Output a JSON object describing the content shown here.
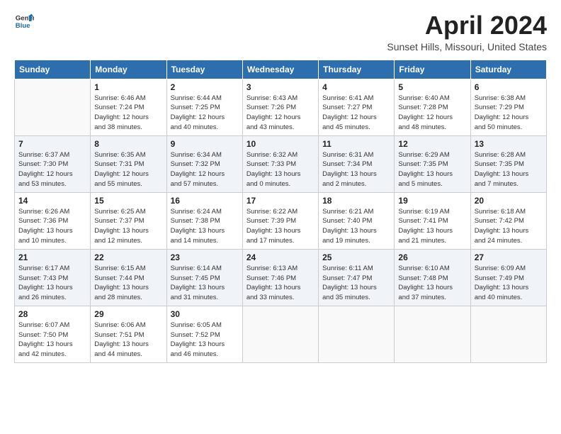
{
  "logo": {
    "general": "General",
    "blue": "Blue"
  },
  "title": "April 2024",
  "subtitle": "Sunset Hills, Missouri, United States",
  "headers": [
    "Sunday",
    "Monday",
    "Tuesday",
    "Wednesday",
    "Thursday",
    "Friday",
    "Saturday"
  ],
  "weeks": [
    [
      {
        "day": "",
        "info": ""
      },
      {
        "day": "1",
        "info": "Sunrise: 6:46 AM\nSunset: 7:24 PM\nDaylight: 12 hours\nand 38 minutes."
      },
      {
        "day": "2",
        "info": "Sunrise: 6:44 AM\nSunset: 7:25 PM\nDaylight: 12 hours\nand 40 minutes."
      },
      {
        "day": "3",
        "info": "Sunrise: 6:43 AM\nSunset: 7:26 PM\nDaylight: 12 hours\nand 43 minutes."
      },
      {
        "day": "4",
        "info": "Sunrise: 6:41 AM\nSunset: 7:27 PM\nDaylight: 12 hours\nand 45 minutes."
      },
      {
        "day": "5",
        "info": "Sunrise: 6:40 AM\nSunset: 7:28 PM\nDaylight: 12 hours\nand 48 minutes."
      },
      {
        "day": "6",
        "info": "Sunrise: 6:38 AM\nSunset: 7:29 PM\nDaylight: 12 hours\nand 50 minutes."
      }
    ],
    [
      {
        "day": "7",
        "info": "Sunrise: 6:37 AM\nSunset: 7:30 PM\nDaylight: 12 hours\nand 53 minutes."
      },
      {
        "day": "8",
        "info": "Sunrise: 6:35 AM\nSunset: 7:31 PM\nDaylight: 12 hours\nand 55 minutes."
      },
      {
        "day": "9",
        "info": "Sunrise: 6:34 AM\nSunset: 7:32 PM\nDaylight: 12 hours\nand 57 minutes."
      },
      {
        "day": "10",
        "info": "Sunrise: 6:32 AM\nSunset: 7:33 PM\nDaylight: 13 hours\nand 0 minutes."
      },
      {
        "day": "11",
        "info": "Sunrise: 6:31 AM\nSunset: 7:34 PM\nDaylight: 13 hours\nand 2 minutes."
      },
      {
        "day": "12",
        "info": "Sunrise: 6:29 AM\nSunset: 7:35 PM\nDaylight: 13 hours\nand 5 minutes."
      },
      {
        "day": "13",
        "info": "Sunrise: 6:28 AM\nSunset: 7:35 PM\nDaylight: 13 hours\nand 7 minutes."
      }
    ],
    [
      {
        "day": "14",
        "info": "Sunrise: 6:26 AM\nSunset: 7:36 PM\nDaylight: 13 hours\nand 10 minutes."
      },
      {
        "day": "15",
        "info": "Sunrise: 6:25 AM\nSunset: 7:37 PM\nDaylight: 13 hours\nand 12 minutes."
      },
      {
        "day": "16",
        "info": "Sunrise: 6:24 AM\nSunset: 7:38 PM\nDaylight: 13 hours\nand 14 minutes."
      },
      {
        "day": "17",
        "info": "Sunrise: 6:22 AM\nSunset: 7:39 PM\nDaylight: 13 hours\nand 17 minutes."
      },
      {
        "day": "18",
        "info": "Sunrise: 6:21 AM\nSunset: 7:40 PM\nDaylight: 13 hours\nand 19 minutes."
      },
      {
        "day": "19",
        "info": "Sunrise: 6:19 AM\nSunset: 7:41 PM\nDaylight: 13 hours\nand 21 minutes."
      },
      {
        "day": "20",
        "info": "Sunrise: 6:18 AM\nSunset: 7:42 PM\nDaylight: 13 hours\nand 24 minutes."
      }
    ],
    [
      {
        "day": "21",
        "info": "Sunrise: 6:17 AM\nSunset: 7:43 PM\nDaylight: 13 hours\nand 26 minutes."
      },
      {
        "day": "22",
        "info": "Sunrise: 6:15 AM\nSunset: 7:44 PM\nDaylight: 13 hours\nand 28 minutes."
      },
      {
        "day": "23",
        "info": "Sunrise: 6:14 AM\nSunset: 7:45 PM\nDaylight: 13 hours\nand 31 minutes."
      },
      {
        "day": "24",
        "info": "Sunrise: 6:13 AM\nSunset: 7:46 PM\nDaylight: 13 hours\nand 33 minutes."
      },
      {
        "day": "25",
        "info": "Sunrise: 6:11 AM\nSunset: 7:47 PM\nDaylight: 13 hours\nand 35 minutes."
      },
      {
        "day": "26",
        "info": "Sunrise: 6:10 AM\nSunset: 7:48 PM\nDaylight: 13 hours\nand 37 minutes."
      },
      {
        "day": "27",
        "info": "Sunrise: 6:09 AM\nSunset: 7:49 PM\nDaylight: 13 hours\nand 40 minutes."
      }
    ],
    [
      {
        "day": "28",
        "info": "Sunrise: 6:07 AM\nSunset: 7:50 PM\nDaylight: 13 hours\nand 42 minutes."
      },
      {
        "day": "29",
        "info": "Sunrise: 6:06 AM\nSunset: 7:51 PM\nDaylight: 13 hours\nand 44 minutes."
      },
      {
        "day": "30",
        "info": "Sunrise: 6:05 AM\nSunset: 7:52 PM\nDaylight: 13 hours\nand 46 minutes."
      },
      {
        "day": "",
        "info": ""
      },
      {
        "day": "",
        "info": ""
      },
      {
        "day": "",
        "info": ""
      },
      {
        "day": "",
        "info": ""
      }
    ]
  ]
}
